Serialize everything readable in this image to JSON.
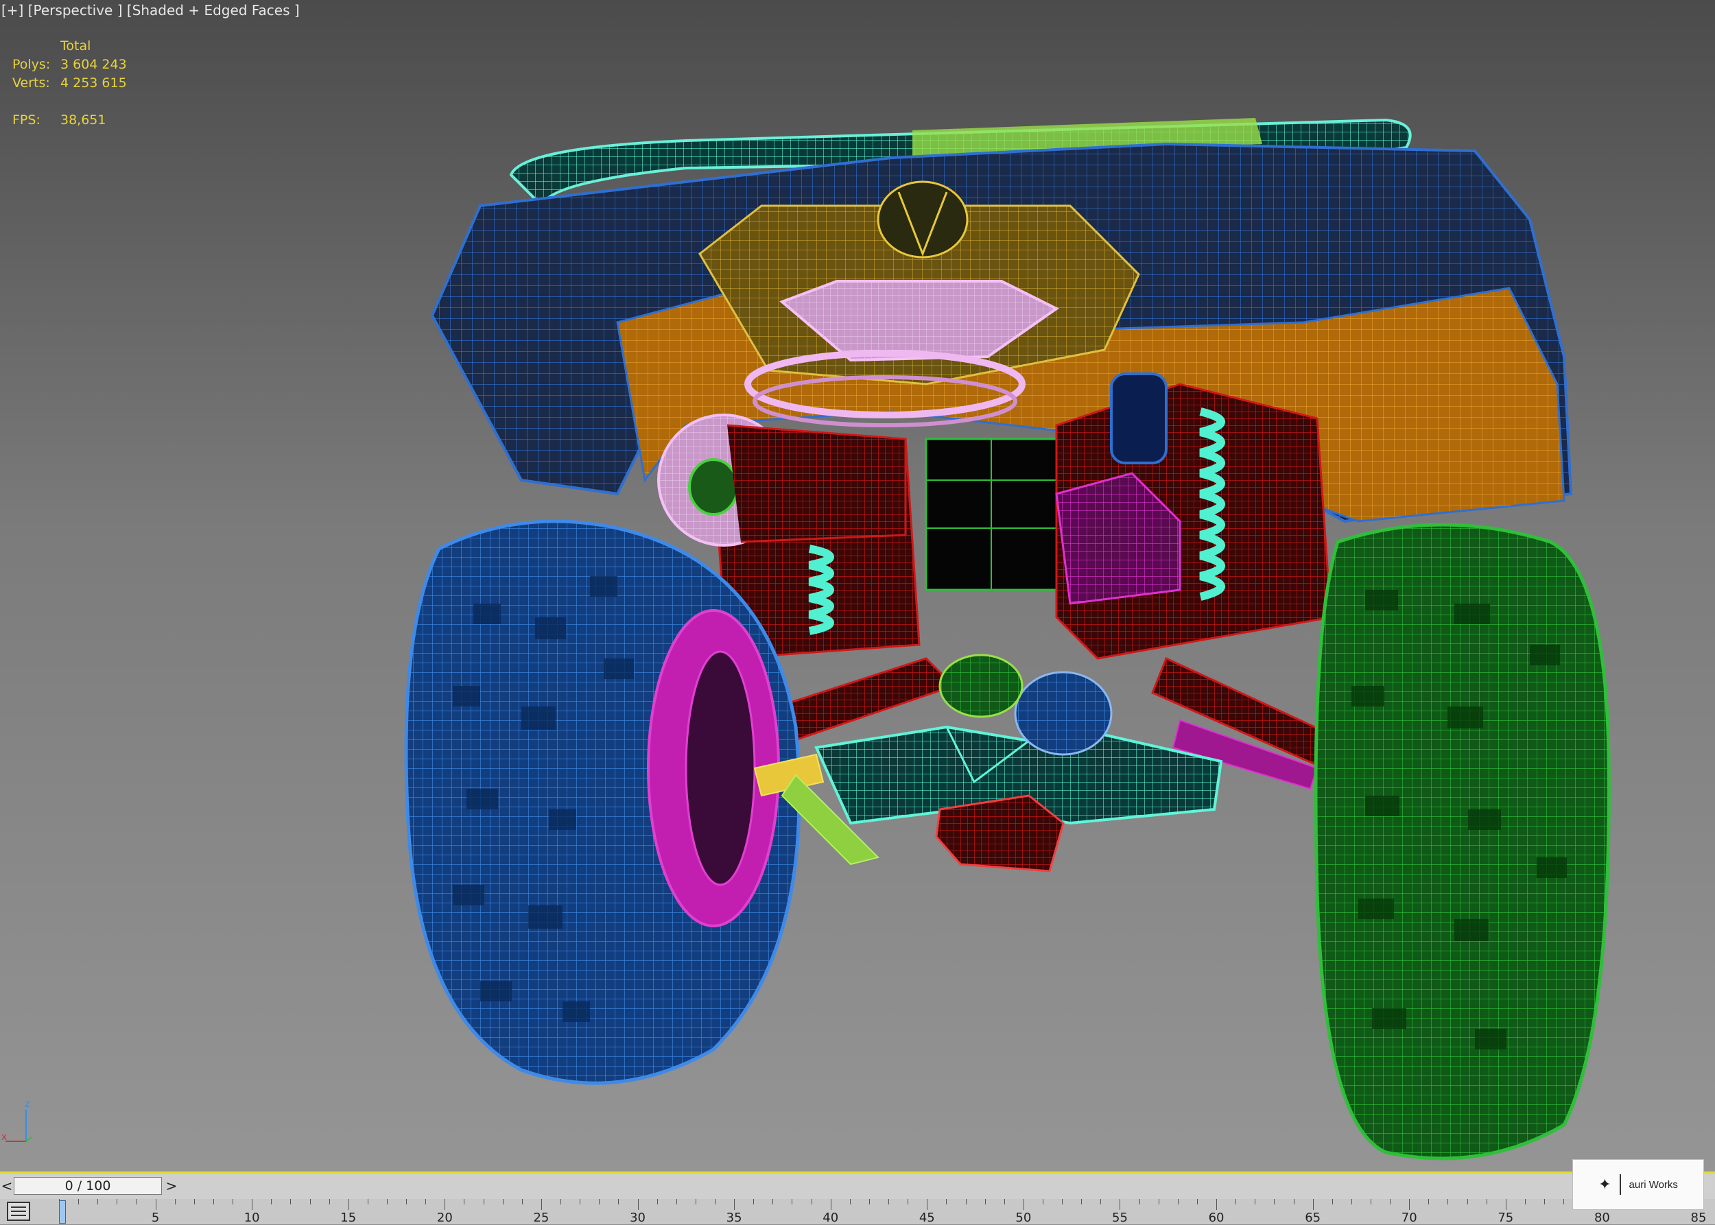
{
  "viewport": {
    "label": "[+] [Perspective ] [Shaded + Edged Faces ]",
    "stats": {
      "header": "Total",
      "polys_label": "Polys:",
      "polys_value": "3 604 243",
      "verts_label": "Verts:",
      "verts_value": "4 253 615",
      "fps_label": "FPS:",
      "fps_value": "38,651"
    },
    "gizmo": {
      "z": "z",
      "x": "x"
    }
  },
  "watermark": {
    "brand": "auri Works",
    "logo_icon": "brand-logo-icon"
  },
  "trackbar": {
    "frame_label": "0 / 100",
    "prev_label": "<",
    "next_label": ">",
    "current_frame": 0,
    "total_frames": 100
  },
  "timeline": {
    "min": 0,
    "max": 85,
    "labels": [
      "5",
      "10",
      "15",
      "20",
      "25",
      "30",
      "35",
      "40",
      "45",
      "50",
      "55",
      "60",
      "65",
      "70",
      "75",
      "80",
      "85"
    ]
  },
  "colors": {
    "accent_yellow": "#e6dc2a",
    "stats_text": "#e8d23c",
    "wire_blue": "#1e5fb4",
    "wire_green": "#1f8f2a",
    "wire_magenta": "#c21fb0",
    "wire_cyan": "#3fe0c0",
    "wire_orange": "#d98a14",
    "wire_red": "#b01414"
  }
}
